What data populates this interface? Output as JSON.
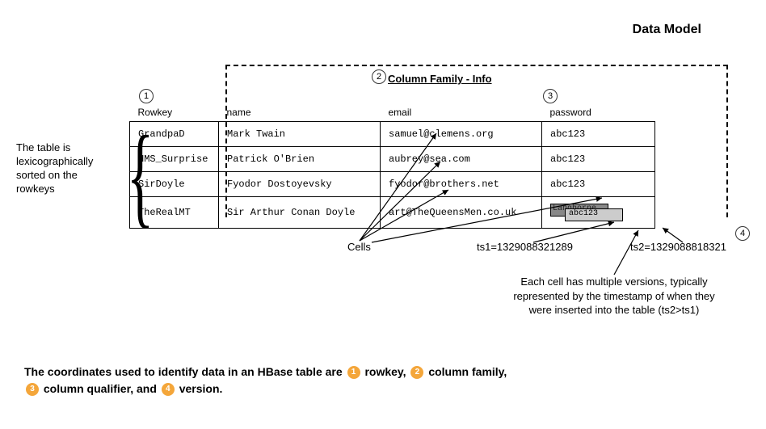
{
  "title": "Data Model",
  "column_family_header": "Column Family - Info",
  "markers": {
    "rowkey": "1",
    "column_family": "2",
    "column_qualifier": "3",
    "version": "4"
  },
  "table": {
    "headers": {
      "rowkey": "Rowkey",
      "name": "name",
      "email": "email",
      "password": "password"
    },
    "rows": [
      {
        "rowkey": "GrandpaD",
        "name": "Mark Twain",
        "email": "samuel@clemens.org",
        "password": "abc123"
      },
      {
        "rowkey": "HMS_Surprise",
        "name": "Patrick O'Brien",
        "email": "aubrey@sea.com",
        "password": "abc123"
      },
      {
        "rowkey": "SirDoyle",
        "name": "Fyodor Dostoyevsky",
        "email": "fyodor@brothers.net",
        "password": "abc123"
      },
      {
        "rowkey": "TheRealMT",
        "name": "Sir Arthur Conan Doyle",
        "email": "art@TheQueensMen.co.uk",
        "password": ""
      }
    ],
    "versioned_cell": {
      "v1": "Langhorne",
      "v2": "abc123"
    }
  },
  "left_note": "The table is lexicographically sorted on the rowkeys",
  "cells_label": "Cells",
  "ts1": "ts1=1329088321289",
  "ts2": "ts2=1329088818321",
  "version_note": "Each cell has multiple versions, typically represented by the timestamp of when they were inserted into the table (ts2>ts1)",
  "caption": {
    "pre": "The coordinates used to identify data in an HBase table are ",
    "p1": "rowkey, ",
    "p2": "column family, ",
    "p3": "column qualifier, and ",
    "p4": "version."
  }
}
